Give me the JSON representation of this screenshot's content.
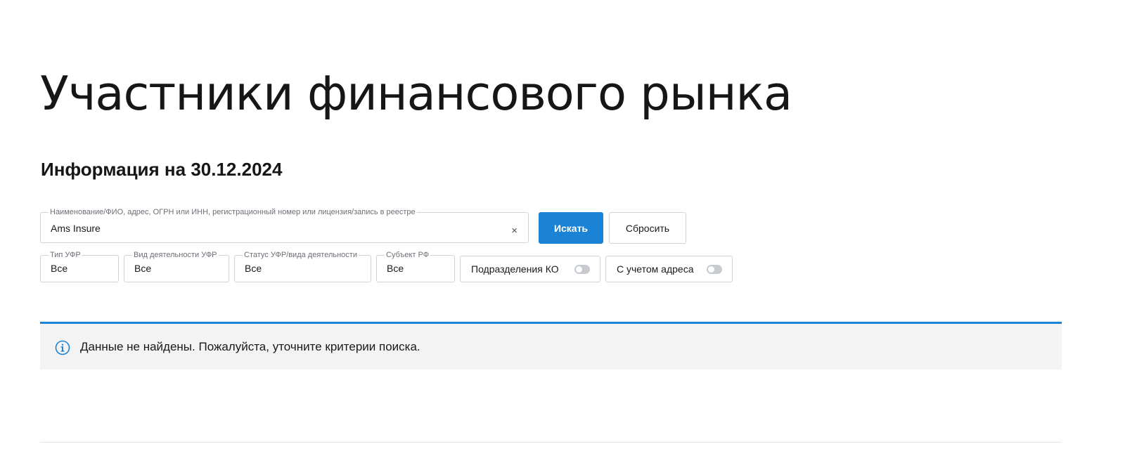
{
  "page": {
    "title": "Участники финансового рынка",
    "date_heading": "Информация на 30.12.2024"
  },
  "search": {
    "legend": "Наименование/ФИО, адрес, ОГРН или ИНН, регистрационный номер или лицензия/запись в реестре",
    "value": "Ams Insure",
    "clear_icon": "×",
    "search_button": "Искать",
    "reset_button": "Сбросить"
  },
  "filters": {
    "type": {
      "legend": "Тип УФР",
      "value": "Все"
    },
    "activity": {
      "legend": "Вид деятельности УФР",
      "value": "Все"
    },
    "status": {
      "legend": "Статус УФР/вида деятельности",
      "value": "Все"
    },
    "region": {
      "legend": "Субъект РФ",
      "value": "Все"
    }
  },
  "toggles": {
    "ko_subdivisions": {
      "label": "Подразделения КО",
      "on": false
    },
    "with_address": {
      "label": "С учетом адреса",
      "on": false
    }
  },
  "notice": {
    "icon": "info-icon",
    "text": "Данные не найдены. Пожалуйста, уточните критерии поиска."
  },
  "colors": {
    "accent": "#1a83d6",
    "notice_background": "#f3f3f3",
    "border": "#cfd3d8"
  }
}
